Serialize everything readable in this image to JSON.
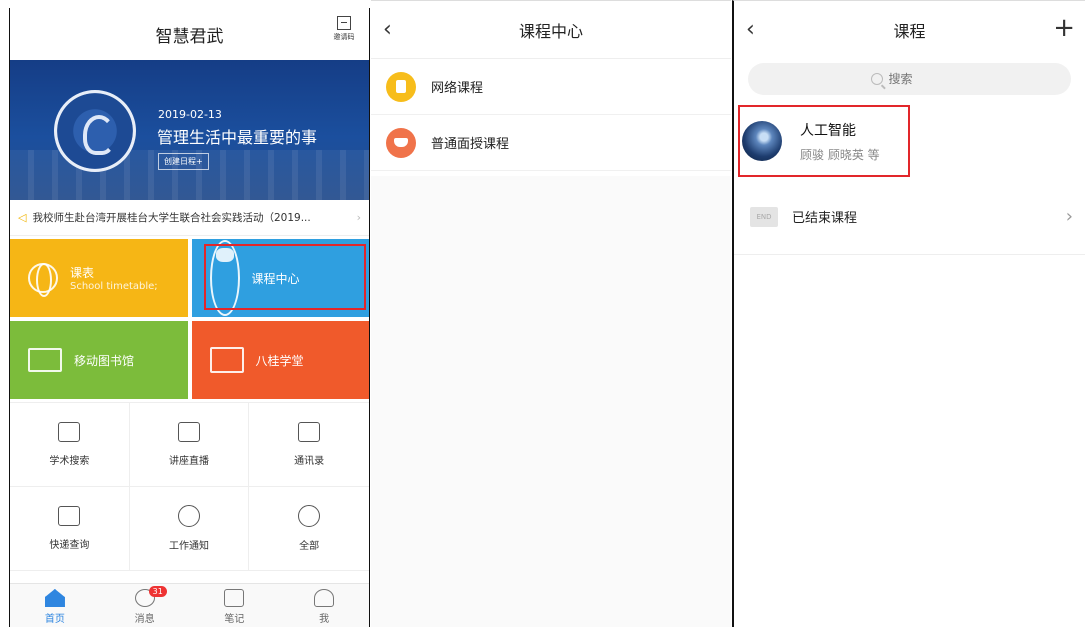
{
  "home": {
    "title": "智慧君武",
    "invite_label": "邀请码",
    "banner": {
      "date": "2019-02-13",
      "slogan": "管理生活中最重要的事",
      "button": "创建日程+"
    },
    "notice": "我校师生赴台湾开展桂台大学生联合社会实践活动（2019...",
    "tiles": [
      {
        "label": "课表",
        "sub": "School timetable;",
        "color": "#f6b615",
        "icon": "globe-icon"
      },
      {
        "label": "课程中心",
        "sub": "",
        "color": "#2f9fe0",
        "icon": "course-icon"
      },
      {
        "label": "移动图书馆",
        "sub": "",
        "color": "#7cbc3b",
        "icon": "library-icon"
      },
      {
        "label": "八桂学堂",
        "sub": "",
        "color": "#f05a2b",
        "icon": "screen-icon"
      }
    ],
    "grid": [
      {
        "label": "学术搜索",
        "icon": "academic-search-icon"
      },
      {
        "label": "讲座直播",
        "icon": "lecture-live-icon"
      },
      {
        "label": "通讯录",
        "icon": "contacts-icon"
      },
      {
        "label": "快递查询",
        "icon": "delivery-icon"
      },
      {
        "label": "工作通知",
        "icon": "notification-icon"
      },
      {
        "label": "全部",
        "icon": "all-apps-icon"
      }
    ],
    "tabs": [
      {
        "label": "首页",
        "icon": "home-icon",
        "active": true
      },
      {
        "label": "消息",
        "icon": "message-icon",
        "badge": "31"
      },
      {
        "label": "笔记",
        "icon": "note-icon"
      },
      {
        "label": "我",
        "icon": "profile-icon"
      }
    ]
  },
  "course_center": {
    "title": "课程中心",
    "items": [
      {
        "label": "网络课程",
        "icon": "online-course-icon",
        "color": "#f7bd1b"
      },
      {
        "label": "普通面授课程",
        "icon": "classroom-course-icon",
        "color": "#f0734a"
      }
    ]
  },
  "courses": {
    "title": "课程",
    "search_placeholder": "搜索",
    "course": {
      "name": "人工智能",
      "teachers": "顾骏 顾晓英 等"
    },
    "ended": {
      "icon_text": "END",
      "label": "已结束课程"
    }
  },
  "colors": {
    "highlight": "#e2262a",
    "accent": "#2f86e0"
  }
}
